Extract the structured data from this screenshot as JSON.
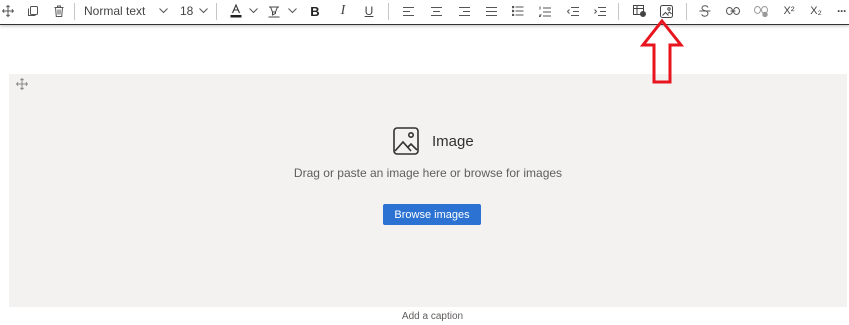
{
  "toolbar": {
    "move_icon": "move-icon",
    "copy_icon": "copy-icon",
    "delete_icon": "trash-icon",
    "text_style": "Normal text",
    "font_size": "18",
    "bold_glyph": "B",
    "italic_glyph": "I",
    "underline_glyph": "U",
    "superscript_glyph": "X²",
    "subscript_glyph": "X₂",
    "more_glyph": "···"
  },
  "image_placeholder": {
    "title": "Image",
    "description": "Drag or paste an image here or browse for images",
    "browse_label": "Browse images"
  },
  "caption": {
    "placeholder": "Add a caption"
  },
  "colors": {
    "accent": "#2b72d2",
    "annotation_arrow": "#e8141e",
    "canvas_bg": "#f3f2f1"
  }
}
